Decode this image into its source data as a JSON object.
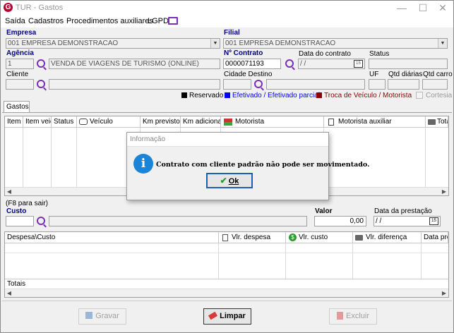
{
  "window": {
    "title": "TUR - Gastos",
    "logo_letter": "G",
    "minimize": "—",
    "maximize": "☐",
    "close": "✕"
  },
  "menu": [
    "Saída",
    "Cadastros",
    "Procedimentos auxiliares",
    "LGPD"
  ],
  "form": {
    "empresa_label": "Empresa",
    "empresa_value": "001 EMPRESA DEMONSTRACAO",
    "filial_label": "Filial",
    "filial_value": "001 EMPRESA DEMONSTRACAO",
    "agencia_label": "Agência",
    "agencia_code": "1",
    "agencia_name": "VENDA DE VIAGENS DE TURISMO (ONLINE)",
    "contrato_label": "Nº Contrato",
    "contrato_value": "0000071193",
    "data_contrato_label": "Data do contrato",
    "data_contrato_value": " / /",
    "status_label": "Status",
    "status_value": "",
    "cliente_label": "Cliente",
    "cliente_code": "",
    "cliente_name": "",
    "cidade_label": "Cidade Destino",
    "cidade_code": "",
    "cidade_name": "",
    "uf_label": "UF",
    "uf_value": "",
    "qtd_diarias_label": "Qtd diárias",
    "qtd_diarias_value": "",
    "qtd_carro_label": "Qtd carro",
    "qtd_carro_value": ""
  },
  "legend": {
    "items": [
      {
        "label": "Reservado",
        "color": "#000000"
      },
      {
        "label": "Efetivado / Efetivado parcial",
        "color": "#0000ff"
      },
      {
        "label": "Troca de Veículo / Motorista",
        "color": "#8b0000"
      }
    ],
    "cortesia_label": "Cortesia"
  },
  "tab": "Gastos",
  "grid1": {
    "columns": [
      "Item",
      "Item veic",
      "Status",
      "Veículo",
      "Km previsto",
      "Km adicional",
      "Motorista",
      "Motorista auxiliar",
      "Tota"
    ]
  },
  "hint": "(F8 para sair)",
  "custo": {
    "label": "Custo",
    "code": "",
    "name": ""
  },
  "valor": {
    "label": "Valor",
    "value": "0,00"
  },
  "data_prestacao": {
    "label": "Data da prestação",
    "value": " / /"
  },
  "grid2": {
    "columns": [
      "Despesa\\Custo",
      "Vlr. despesa",
      "Vlr. custo",
      "Vlr. diferença",
      "Data prest"
    ],
    "totals_label": "Totais"
  },
  "buttons": {
    "gravar": "Gravar",
    "limpar": "Limpar",
    "excluir": "Excluir"
  },
  "dialog": {
    "title": "Informação",
    "message": "Contrato com cliente padrão não pode ser movimentado.",
    "ok": "Ok",
    "icon_glyph": "i"
  },
  "colors": {
    "accent_purple": "#7a2fb8",
    "label_blue": "#000080",
    "logo_red": "#b8002e"
  }
}
